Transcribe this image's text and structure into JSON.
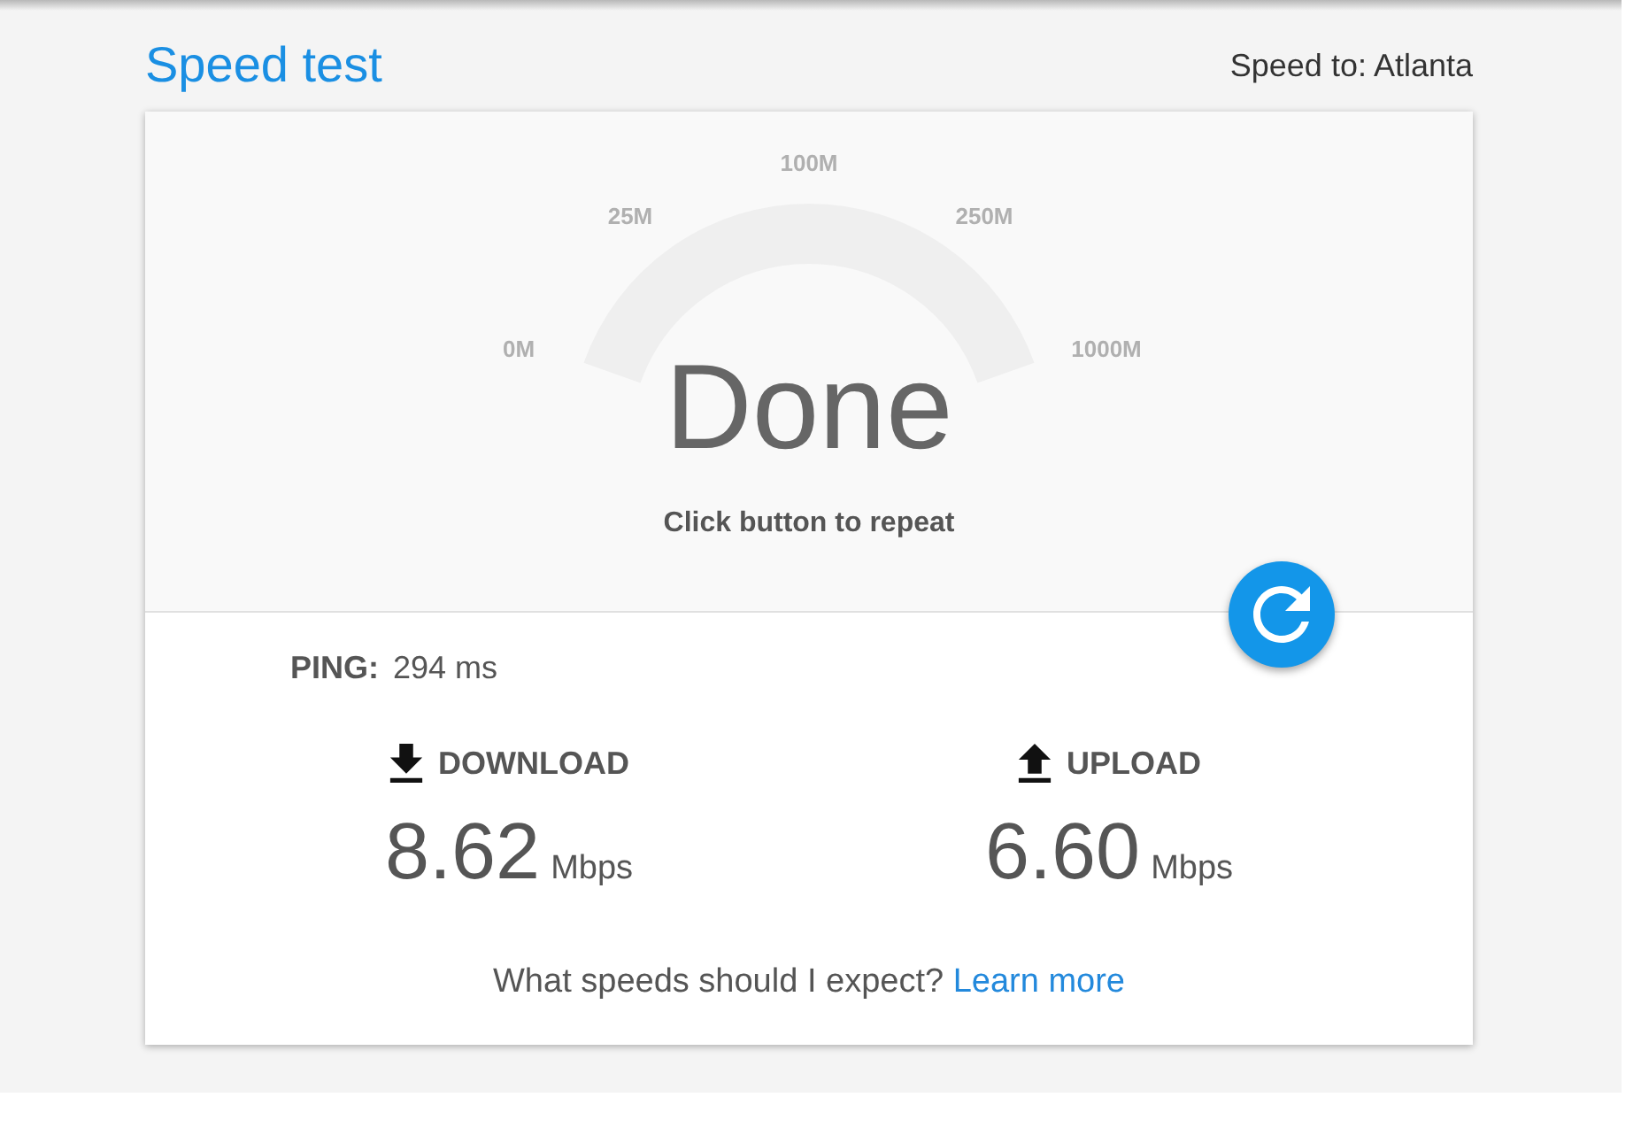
{
  "header": {
    "title": "Speed test",
    "server_label": "Speed to: Atlanta"
  },
  "gauge": {
    "ticks": [
      "0M",
      "25M",
      "100M",
      "250M",
      "1000M"
    ],
    "status": "Done",
    "hint": "Click button to repeat"
  },
  "ping": {
    "label": "PING:",
    "value": "294 ms"
  },
  "results": [
    {
      "kind": "download",
      "label": "DOWNLOAD",
      "value": "8.62",
      "unit": "Mbps"
    },
    {
      "kind": "upload",
      "label": "UPLOAD",
      "value": "6.60",
      "unit": "Mbps"
    }
  ],
  "footer": {
    "text": "What speeds should I expect?",
    "link": "Learn more"
  }
}
